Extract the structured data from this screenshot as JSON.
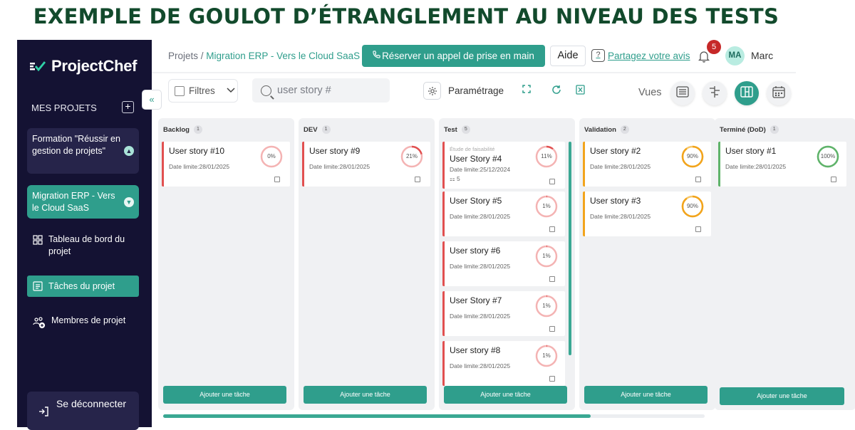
{
  "headline": "EXEMPLE DE GOULOT D’ÉTRANGLEMENT AU NIVEAU DES TESTS",
  "sidebar": {
    "logo": "ProjectChef",
    "section_label": "MES PROJETS",
    "add_project": "+",
    "projects": [
      {
        "name": "Formation \"Réussir en gestion de projets\"",
        "chevron": "▲"
      },
      {
        "name": "Migration ERP - Vers le Cloud SaaS",
        "chevron": "▼"
      }
    ],
    "nav": {
      "dashboard": "Tableau de bord du projet",
      "tasks": "Tâches du projet",
      "members": "Membres de projet"
    },
    "logout": "Se déconnecter",
    "collapse": "«"
  },
  "topbar": {
    "breadcrumb_root": "Projets",
    "breadcrumb_sep": " / ",
    "breadcrumb_current": "Migration ERP - Vers le Cloud SaaS",
    "book_call": "Réserver un appel de prise en main",
    "help": "Aide",
    "feedback_icon": "?",
    "feedback": "Partagez votre avis",
    "notifications_count": "5",
    "avatar_initials": "MA",
    "username": "Marc"
  },
  "toolbar": {
    "filters": "Filtres",
    "search_placeholder": "user story #",
    "settings": "Paramétrage",
    "views_label": "Vues"
  },
  "colors": {
    "accent": "#2f9e8c",
    "red": "#e15050",
    "orange": "#f2a41c",
    "green": "#5fb36a"
  },
  "board": {
    "add_task_label": "Ajouter une tâche",
    "columns": [
      {
        "name": "Backlog",
        "count": "1",
        "cards": [
          {
            "name": "User story #10",
            "date": "Date limite:28/01/2025",
            "progress": 0,
            "progress_label": "0%",
            "status": "red"
          }
        ]
      },
      {
        "name": "DEV",
        "count": "1",
        "cards": [
          {
            "name": "User story #9",
            "date": "Date limite:28/01/2025",
            "progress": 21,
            "progress_label": "21%",
            "status": "red"
          }
        ]
      },
      {
        "name": "Test",
        "count": "5",
        "cards": [
          {
            "sub": "Étude de faisabilité",
            "name": "User Story #4",
            "date": "Date limite:25/12/2024",
            "subtasks": "5",
            "progress": 11,
            "progress_label": "11%",
            "status": "red"
          },
          {
            "name": "User Story #5",
            "date": "Date limite:28/01/2025",
            "progress": 1,
            "progress_label": "1%",
            "status": "red"
          },
          {
            "name": "User story #6",
            "date": "Date limite:28/01/2025",
            "progress": 1,
            "progress_label": "1%",
            "status": "red"
          },
          {
            "name": "User Story #7",
            "date": "Date limite:28/01/2025",
            "progress": 1,
            "progress_label": "1%",
            "status": "red"
          },
          {
            "name": "User story #8",
            "date": "Date limite:28/01/2025",
            "progress": 1,
            "progress_label": "1%",
            "status": "red"
          }
        ]
      },
      {
        "name": "Validation",
        "count": "2",
        "cards": [
          {
            "name": "User story #2",
            "date": "Date limite:28/01/2025",
            "progress": 90,
            "progress_label": "90%",
            "status": "orange"
          },
          {
            "name": "User story #3",
            "date": "Date limite:28/01/2025",
            "progress": 90,
            "progress_label": "90%",
            "status": "orange"
          }
        ]
      },
      {
        "name": "Terminé (DoD)",
        "count": "1",
        "cards": [
          {
            "name": "User story #1",
            "date": "Date limite:28/01/2025",
            "progress": 100,
            "progress_label": "100%",
            "status": "green"
          }
        ]
      }
    ]
  }
}
